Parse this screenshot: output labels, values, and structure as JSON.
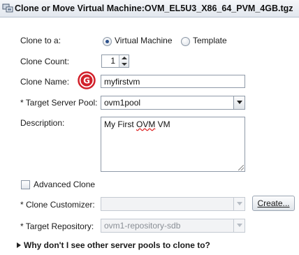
{
  "dialog": {
    "title": "Clone or Move Virtual Machine:OVM_EL5U3_X86_64_PVM_4GB.tgz"
  },
  "clone_to": {
    "label": "Clone to a:",
    "options": [
      "Virtual Machine",
      "Template"
    ],
    "selected": "Virtual Machine"
  },
  "clone_count": {
    "label": "Clone Count:",
    "value": "1"
  },
  "clone_name": {
    "label": "Clone Name:",
    "value": "myfirstvm"
  },
  "target_server_pool": {
    "label": "* Target Server Pool:",
    "value": "ovm1pool"
  },
  "description": {
    "label": "Description:",
    "value_prefix": "My First ",
    "value_flagged": "OVM",
    "value_suffix": " VM"
  },
  "advanced_clone": {
    "label": "Advanced Clone",
    "checked": false
  },
  "clone_customizer": {
    "label": "* Clone Customizer:",
    "value": "",
    "create_label": "Create..."
  },
  "target_repository": {
    "label": "* Target Repository:",
    "value": "ovm1-repository-sdb"
  },
  "help": {
    "text": "Why don't I see other server pools to clone to?"
  },
  "colors": {
    "accent": "#2b4f8a",
    "titlebar": "#e6eaf0",
    "annotation_red": "#d2202a"
  }
}
